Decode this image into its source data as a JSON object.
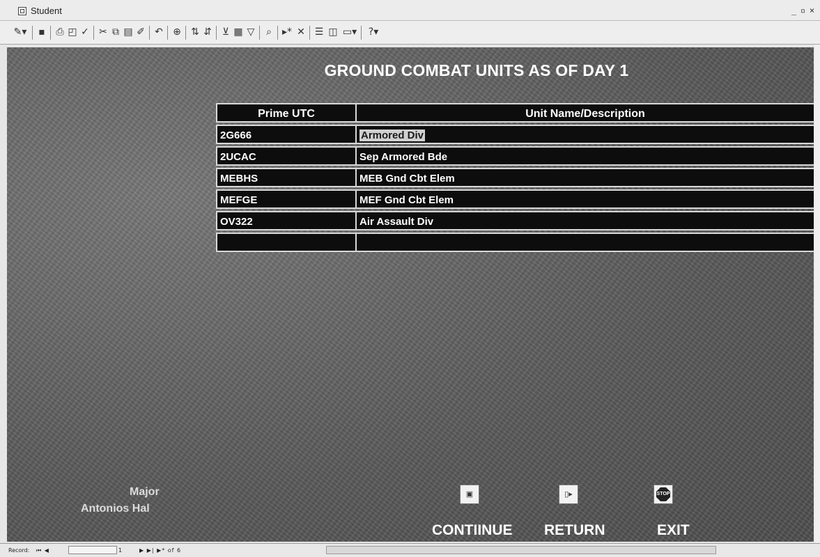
{
  "window": {
    "title": "Student",
    "controls": [
      "_",
      "▫",
      "×"
    ]
  },
  "toolbar": {
    "icons": [
      "design-view-icon",
      "save-icon",
      "print-icon",
      "print-preview-icon",
      "spelling-icon",
      "cut-icon",
      "copy-icon",
      "paste-icon",
      "format-painter-icon",
      "undo-icon",
      "hyperlink-icon",
      "sort-ascending-icon",
      "sort-descending-icon",
      "filter-by-selection-icon",
      "filter-by-form-icon",
      "apply-filter-icon",
      "find-icon",
      "new-record-icon",
      "delete-record-icon",
      "properties-icon",
      "database-window-icon",
      "new-object-icon",
      "help-icon"
    ]
  },
  "form": {
    "title": "GROUND COMBAT UNITS AS OF DAY 1",
    "columns": [
      "Prime UTC",
      "Unit Name/Description"
    ],
    "rows": [
      {
        "utc": "2G666",
        "name": "Armored Div"
      },
      {
        "utc": "2UCAC",
        "name": "Sep Armored Bde"
      },
      {
        "utc": "MEBHS",
        "name": "MEB Gnd Cbt Elem"
      },
      {
        "utc": "MEFGE",
        "name": "MEF Gnd Cbt Elem"
      },
      {
        "utc": "OV322",
        "name": "Air Assault Div"
      },
      {
        "utc": "",
        "name": ""
      }
    ],
    "rank": "Major",
    "person": "Antonios Hal",
    "buttons": {
      "continue": "CONTIINUE",
      "return": "RETURN",
      "exit": "EXIT",
      "stop_text": "STOP"
    }
  },
  "statusbar": {
    "record_label": "Record:",
    "nav": "⏮ ◀",
    "current": "1",
    "of_text": "▶ ▶| ▶* of 6"
  }
}
